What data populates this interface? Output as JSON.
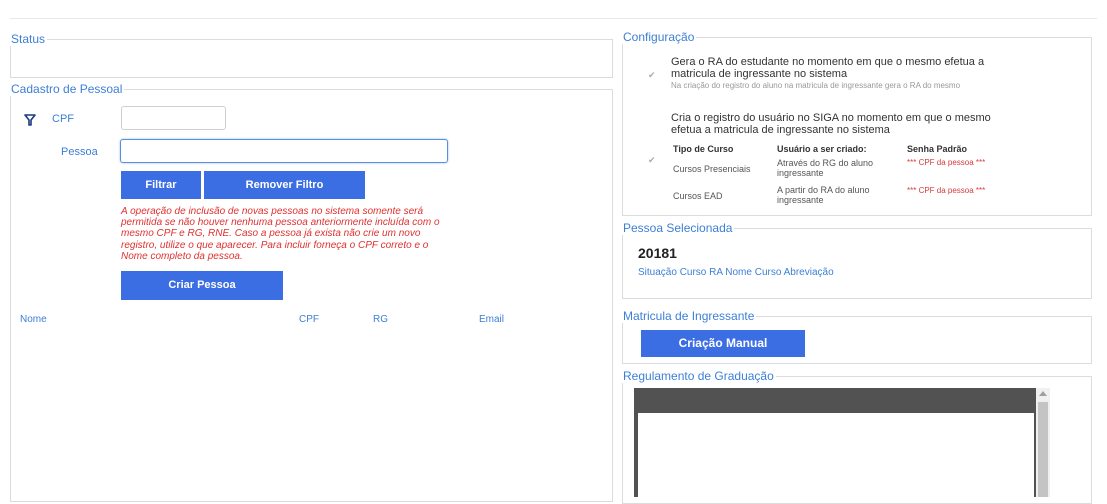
{
  "status": {
    "legend": "Status"
  },
  "cadastro": {
    "legend": "Cadastro de Pessoal",
    "cpf_label": "CPF",
    "cpf_value": "",
    "pessoa_label": "Pessoa",
    "pessoa_value": "",
    "filtrar_label": "Filtrar",
    "remover_filtro_label": "Remover Filtro",
    "warning": "A operação de inclusão de novas pessoas no sistema somente será permitida se não houver nenhuma pessoa anteriormente incluída com o mesmo CPF e RG, RNE. Caso a pessoa já exista não crie um novo registro, utilize o que aparecer. Para incluir forneça o CPF correto e o Nome completo da pessoa.",
    "criar_pessoa_label": "Criar Pessoa",
    "columns": [
      "Nome",
      "CPF",
      "RG",
      "Email"
    ]
  },
  "configuracao": {
    "legend": "Configuração",
    "option1": {
      "checked": true,
      "title": "Gera o RA do estudante no momento em que o mesmo efetua a matricula de ingressante no sistema",
      "subtitle": "Na criação do registro do aluno na matricula de ingressante gera o RA do mesmo"
    },
    "option2": {
      "checked": true,
      "title": "Cria o registro do usuário no SIGA  no momento em que o mesmo efetua a matricula de ingressante no sistema"
    },
    "table": {
      "headers": [
        "Tipo de Curso",
        "Usuário a ser criado:",
        "Senha Padrão"
      ],
      "rows": [
        [
          "Cursos Presenciais",
          "Através do RG do aluno ingressante",
          "*** CPF da pessoa ***"
        ],
        [
          "Cursos EAD",
          "A partir do RA do aluno ingressante",
          "*** CPF da pessoa ***"
        ]
      ]
    }
  },
  "pessoa_selecionada": {
    "legend": "Pessoa Selecionada",
    "id": "20181",
    "columns": "Situação Curso RA Nome Curso Abreviação"
  },
  "matricula": {
    "legend": "Matricula de Ingressante",
    "button_label": "Criação Manual"
  },
  "regulamento": {
    "legend": "Regulamento de Graduação"
  },
  "colors": {
    "accent": "#3c6ee3",
    "label_blue": "#3d7fd6",
    "warning_red": "#e03030"
  },
  "icons": {
    "filter": "filter-icon",
    "check": "check-icon"
  }
}
